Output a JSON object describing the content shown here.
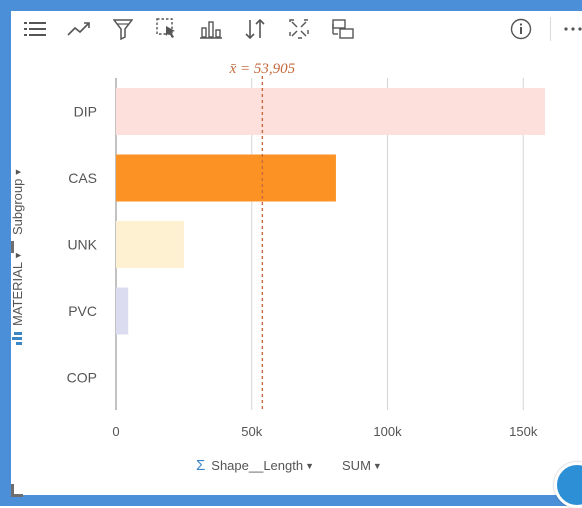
{
  "toolbar": {
    "buttons": [
      {
        "name": "legend-list-icon"
      },
      {
        "name": "trend-line-icon"
      },
      {
        "name": "filter-icon"
      },
      {
        "name": "selection-icon"
      },
      {
        "name": "visualization-type-icon"
      },
      {
        "name": "sort-icon"
      },
      {
        "name": "maximize-icon"
      },
      {
        "name": "flip-card-icon"
      },
      {
        "name": "info-icon"
      },
      {
        "name": "more-options-icon"
      }
    ]
  },
  "axes": {
    "y_field": "Subgroup",
    "y_field_group": "MATERIAL",
    "x_field": "Shape__Length",
    "x_aggregation": "SUM"
  },
  "chart_data": {
    "type": "bar",
    "orientation": "horizontal",
    "categories": [
      "DIP",
      "CAS",
      "UNK",
      "PVC",
      "COP"
    ],
    "values": [
      158000,
      81000,
      25000,
      4500,
      0
    ],
    "colors": [
      "#fddfdb",
      "#fb9223",
      "#fdf1d1",
      "#dcdcf0",
      "#dddddd"
    ],
    "x_ticks": [
      0,
      50000,
      100000,
      150000
    ],
    "x_tick_labels": [
      "0",
      "50k",
      "100k",
      "150k"
    ],
    "xlim": [
      0,
      158000
    ],
    "mean": 53905,
    "mean_label": "x̄ = 53,905",
    "grid": true
  },
  "colors": {
    "accent": "#4a8fd8",
    "mean_line": "#c46a3c",
    "grid": "#d4d4d4"
  }
}
